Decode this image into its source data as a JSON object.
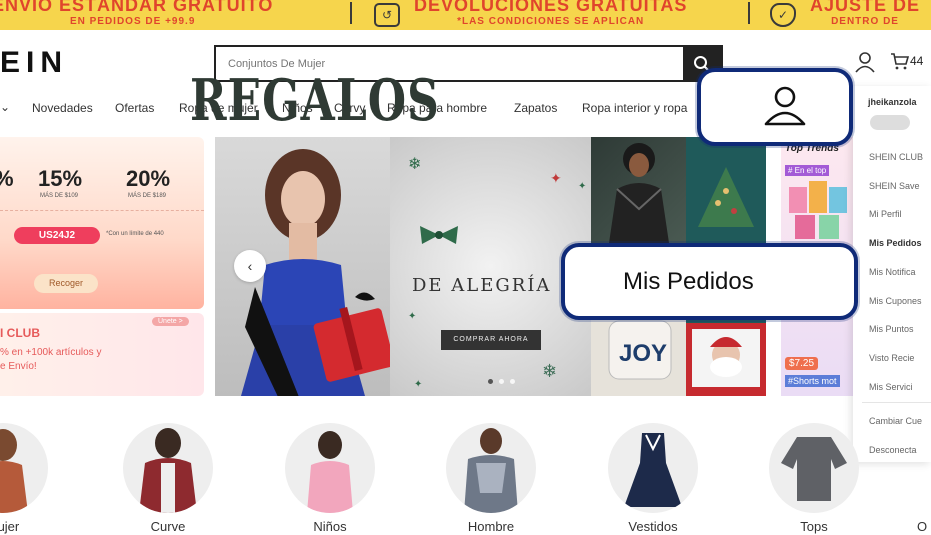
{
  "promo": {
    "items": [
      {
        "title": "ENVÍO ESTÁNDAR GRATUITO",
        "subtitle": "EN PEDIDOS DE +99.9"
      },
      {
        "title": "DEVOLUCIONES GRATUITAS",
        "subtitle": "*LAS CONDICIONES SE APLICAN"
      },
      {
        "title": "AJUSTE DE",
        "subtitle": "DENTRO DE"
      }
    ]
  },
  "header": {
    "logo": "EIN",
    "search_placeholder": "Conjuntos De Mujer",
    "cart_count": "44"
  },
  "nav": {
    "items": [
      "Novedades",
      "Ofertas",
      "Ropa de mujer",
      "Niños",
      "Curvy",
      "Ropa para hombre",
      "Zapatos",
      "Ropa interior y ropa"
    ]
  },
  "left_card": {
    "discounts": [
      {
        "pct": "15%",
        "note": "MÁS DE $109"
      },
      {
        "pct": "20%",
        "note": "MÁS DE $189"
      }
    ],
    "code": "US24J2",
    "code_note": "*Con un límite de 440",
    "collect": "Recoger",
    "club_title": "I CLUB",
    "club_line1": "% en +100k artículos y",
    "club_line2": "e Envío!",
    "club_tag": "Únete >"
  },
  "hero": {
    "title": "REGALOS",
    "subtitle": "DE ALEGRÍA",
    "cta": "COMPRAR AHORA",
    "dots": 3,
    "active_dot": 0
  },
  "tiles": {
    "top_trends": "Top Trends",
    "trend_tag": "# En el top",
    "price": "$7.25",
    "shorts_tag": "#Shorts mot"
  },
  "dropdown": {
    "username": "jheikanzola",
    "items": [
      "SHEIN CLUB",
      "SHEIN Save",
      "Mi Perfil",
      "Mis Pedidos",
      "Mis Notifica",
      "Mis Cupones",
      "Mis Puntos",
      "Visto Recie",
      "Mis Servici"
    ],
    "footer": [
      "Cambiar Cue",
      "Desconecta"
    ]
  },
  "categories": [
    "Mujer",
    "Curve",
    "Niños",
    "Hombre",
    "Vestidos",
    "Tops"
  ],
  "callouts": {
    "orders_label": "Mis Pedidos"
  },
  "colors": {
    "promo_bg": "#f6d54c",
    "promo_text": "#e0452c",
    "callout_border": "#0f2a78",
    "code_pill": "#ef3e5d"
  }
}
